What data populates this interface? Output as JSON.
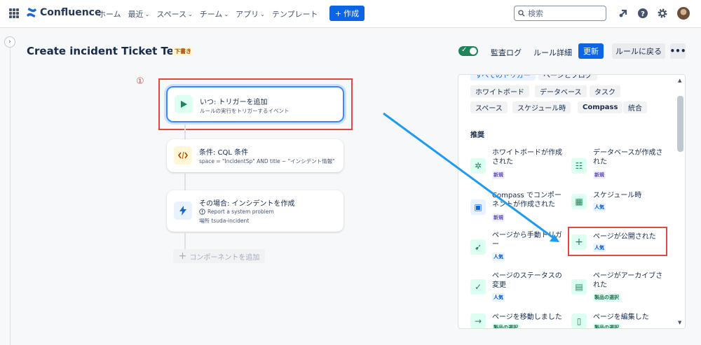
{
  "topnav": {
    "brand": "Confluence",
    "items": [
      {
        "label": "ホーム",
        "has_chevron": false
      },
      {
        "label": "最近",
        "has_chevron": true
      },
      {
        "label": "スペース",
        "has_chevron": true
      },
      {
        "label": "チーム",
        "has_chevron": true
      },
      {
        "label": "アプリ",
        "has_chevron": true
      },
      {
        "label": "テンプレート",
        "has_chevron": false
      }
    ],
    "create_label": "作成",
    "search_placeholder": "検索"
  },
  "header": {
    "title": "Create incident Ticket Test",
    "status_badge": "下書き",
    "audit_log": "監査ログ",
    "rule_details": "ルール詳細",
    "update": "更新",
    "back_to_rules": "ルールに戻る"
  },
  "annotation": {
    "step": "①"
  },
  "flow": {
    "trigger": {
      "title": "いつ: トリガーを追加",
      "subtitle": "ルールの実行をトリガーするイベント"
    },
    "condition": {
      "title": "条件: CQL 条件",
      "subtitle": "space = \"IncidentSp\" AND title ~ \"インシデント情報\""
    },
    "action": {
      "title": "その場合: インシデントを作成",
      "line1": "Report a system problem",
      "line2": "場所 tsuda-incident"
    },
    "add_component": "コンポーネントを追加"
  },
  "panel": {
    "chips_partial": [
      "すべてのトリガー",
      "ページとブログ"
    ],
    "chips_row1": [
      "ホワイトボード",
      "データベース",
      "タスク"
    ],
    "chips_row2": [
      "スペース",
      "スケジュール時",
      "Compass",
      "統合"
    ],
    "recommended_label": "推奨",
    "tiles": [
      {
        "label": "ホワイトボードが作成された",
        "tag": "新規"
      },
      {
        "label": "データベースが作成された",
        "tag": "新規"
      },
      {
        "label": "Compass でコンポーネントが作成された",
        "tag": "新規"
      },
      {
        "label": "スケジュール時",
        "tag": "人気"
      },
      {
        "label": "ページから手動トリガー",
        "tag": "人気"
      },
      {
        "label": "ページが公開された",
        "tag": "人気"
      },
      {
        "label": "ページのステータスの変更",
        "tag": "人気"
      },
      {
        "label": "ページがアーカイブされた",
        "tag": "製品の選択"
      },
      {
        "label": "ページを移動しました",
        "tag": "製品の選択"
      },
      {
        "label": "ページを編集した",
        "tag": "製品の選択"
      }
    ]
  },
  "colors": {
    "accent": "#0c66e4",
    "annotation_red": "#e2483d",
    "arrow": "#1d9bf0",
    "success": "#1f845a"
  }
}
